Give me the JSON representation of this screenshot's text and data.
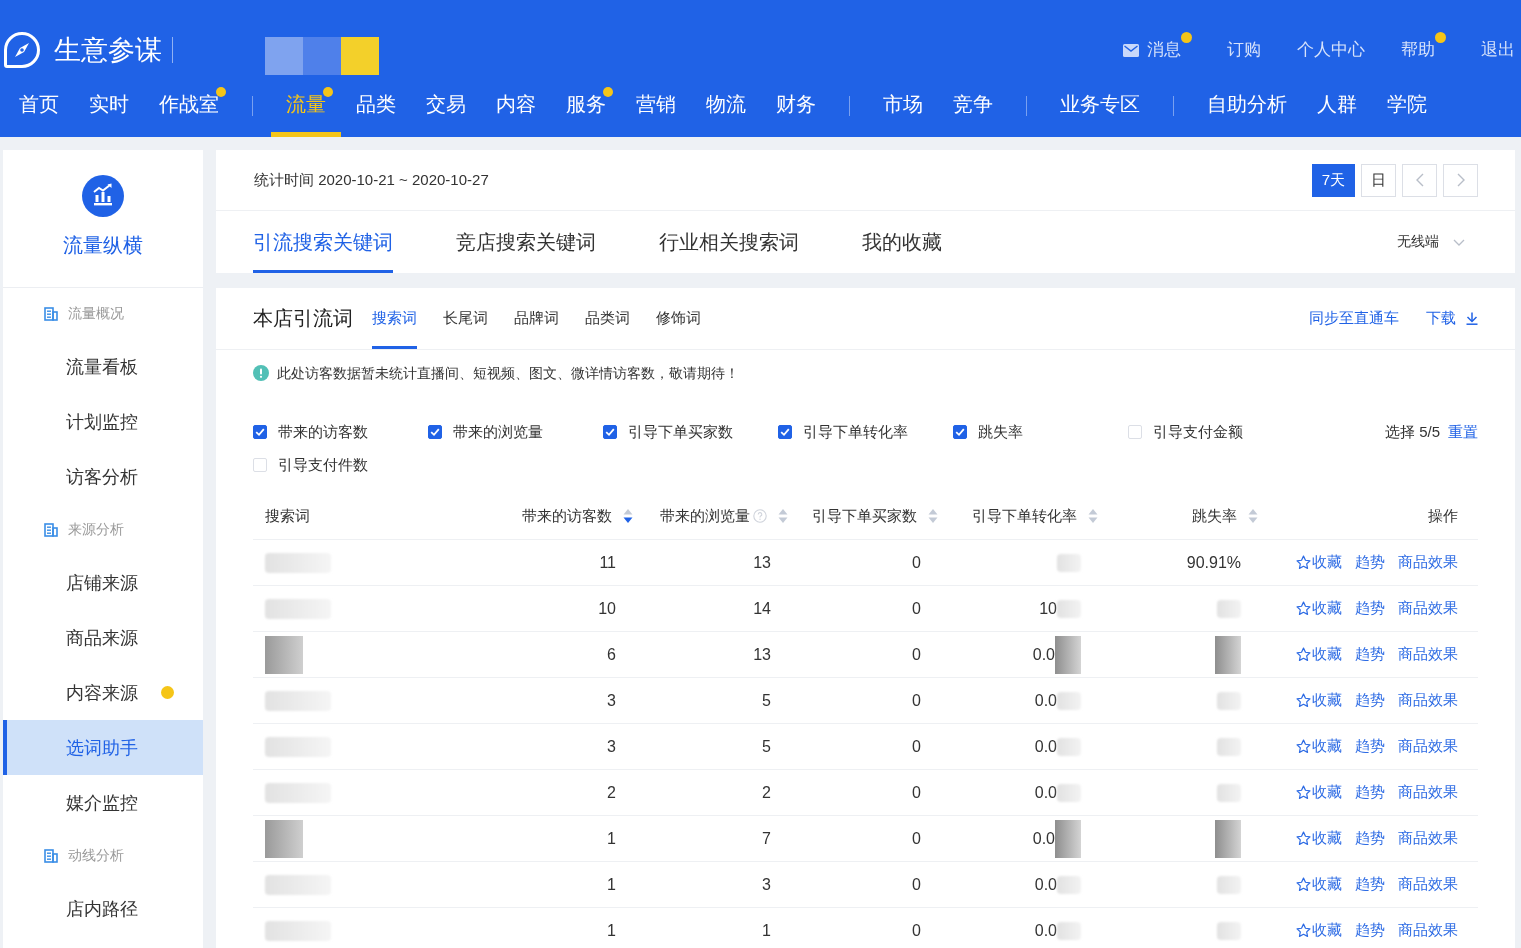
{
  "header": {
    "logo": "生意参谋",
    "shop_name_blurred": true,
    "links": [
      {
        "label": "消息",
        "kind": "mail",
        "dot": true
      },
      {
        "label": "订购",
        "kind": "plain",
        "dot": false
      },
      {
        "label": "个人中心",
        "kind": "plain",
        "dot": false
      },
      {
        "label": "帮助",
        "kind": "plain",
        "dot": true
      },
      {
        "label": "退出",
        "kind": "plain",
        "dot": false
      }
    ],
    "nav_groups": [
      [
        {
          "label": "首页",
          "selected": false,
          "dot": false
        },
        {
          "label": "实时",
          "selected": false,
          "dot": false
        },
        {
          "label": "作战室",
          "selected": false,
          "dot": true
        }
      ],
      [
        {
          "label": "流量",
          "selected": true,
          "dot": true
        },
        {
          "label": "品类",
          "selected": false,
          "dot": false
        },
        {
          "label": "交易",
          "selected": false,
          "dot": false
        },
        {
          "label": "内容",
          "selected": false,
          "dot": false
        },
        {
          "label": "服务",
          "selected": false,
          "dot": true
        },
        {
          "label": "营销",
          "selected": false,
          "dot": false
        },
        {
          "label": "物流",
          "selected": false,
          "dot": false
        },
        {
          "label": "财务",
          "selected": false,
          "dot": false
        }
      ],
      [
        {
          "label": "市场",
          "selected": false,
          "dot": false
        },
        {
          "label": "竞争",
          "selected": false,
          "dot": false
        }
      ],
      [
        {
          "label": "业务专区",
          "selected": false,
          "dot": false
        }
      ],
      [
        {
          "label": "自助分析",
          "selected": false,
          "dot": false
        },
        {
          "label": "人群",
          "selected": false,
          "dot": false
        },
        {
          "label": "学院",
          "selected": false,
          "dot": false
        }
      ]
    ]
  },
  "sidebar": {
    "title": "流量纵横",
    "groups": [
      {
        "label": "流量概况",
        "items": [
          {
            "label": "流量看板",
            "selected": false,
            "dot": false
          },
          {
            "label": "计划监控",
            "selected": false,
            "dot": false
          },
          {
            "label": "访客分析",
            "selected": false,
            "dot": false
          }
        ]
      },
      {
        "label": "来源分析",
        "items": [
          {
            "label": "店铺来源",
            "selected": false,
            "dot": false
          },
          {
            "label": "商品来源",
            "selected": false,
            "dot": false
          },
          {
            "label": "内容来源",
            "selected": false,
            "dot": true
          },
          {
            "label": "选词助手",
            "selected": true,
            "dot": false
          },
          {
            "label": "媒介监控",
            "selected": false,
            "dot": false
          }
        ]
      },
      {
        "label": "动线分析",
        "items": [
          {
            "label": "店内路径",
            "selected": false,
            "dot": false
          }
        ]
      }
    ]
  },
  "period": {
    "label": "统计时间 2020-10-21 ~ 2020-10-27",
    "ranges": [
      {
        "label": "7天",
        "selected": true
      },
      {
        "label": "日",
        "selected": false
      }
    ],
    "tabs": [
      {
        "label": "引流搜索关键词",
        "selected": true
      },
      {
        "label": "竞店搜索关键词",
        "selected": false
      },
      {
        "label": "行业相关搜索词",
        "selected": false
      },
      {
        "label": "我的收藏",
        "selected": false
      }
    ],
    "device": "无线端"
  },
  "panel": {
    "title": "本店引流词",
    "subtabs": [
      {
        "label": "搜索词",
        "selected": true
      },
      {
        "label": "长尾词",
        "selected": false
      },
      {
        "label": "品牌词",
        "selected": false
      },
      {
        "label": "品类词",
        "selected": false
      },
      {
        "label": "修饰词",
        "selected": false
      }
    ],
    "sync_link": "同步至直通车",
    "download": "下载",
    "notice": "此处访客数据暂未统计直播间、短视频、图文、微详情访客数，敬请期待！",
    "metrics": [
      {
        "label": "带来的访客数",
        "checked": true
      },
      {
        "label": "带来的浏览量",
        "checked": true
      },
      {
        "label": "引导下单买家数",
        "checked": true
      },
      {
        "label": "引导下单转化率",
        "checked": true
      },
      {
        "label": "跳失率",
        "checked": true
      },
      {
        "label": "引导支付金额",
        "checked": false
      },
      {
        "label": "引导支付件数",
        "checked": false
      }
    ],
    "selection": "选择 5/5",
    "reset": "重置",
    "table": {
      "columns": [
        {
          "label": "搜索词",
          "sortable": false,
          "sorted": false,
          "help": false
        },
        {
          "label": "带来的访客数",
          "sortable": true,
          "sorted": true,
          "help": false
        },
        {
          "label": "带来的浏览量",
          "sortable": true,
          "sorted": false,
          "help": true
        },
        {
          "label": "引导下单买家数",
          "sortable": true,
          "sorted": false,
          "help": false
        },
        {
          "label": "引导下单转化率",
          "sortable": true,
          "sorted": false,
          "help": false
        },
        {
          "label": "跳失率",
          "sortable": true,
          "sorted": false,
          "help": false
        },
        {
          "label": "操作",
          "sortable": false,
          "sorted": false,
          "help": false
        }
      ],
      "rows": [
        {
          "cells": [
            {
              "kind": "blurred"
            },
            {
              "text": "11",
              "kind": "plain"
            },
            {
              "text": "13",
              "kind": "plain"
            },
            {
              "text": "0",
              "kind": "plain"
            },
            {
              "kind": "blurred"
            },
            {
              "text": "90.91%",
              "kind": "plain"
            }
          ],
          "actions": [
            {
              "label": "收藏",
              "kind": "star"
            },
            {
              "label": "趋势",
              "kind": "plain"
            },
            {
              "label": "商品效果",
              "kind": "plain"
            }
          ]
        },
        {
          "cells": [
            {
              "kind": "blurred"
            },
            {
              "text": "10",
              "kind": "plain"
            },
            {
              "text": "14",
              "kind": "plain"
            },
            {
              "text": "0",
              "kind": "plain"
            },
            {
              "text": "10",
              "kind": "blurred"
            },
            {
              "kind": "blurred"
            }
          ],
          "actions": [
            {
              "label": "收藏",
              "kind": "star"
            },
            {
              "label": "趋势",
              "kind": "plain"
            },
            {
              "label": "商品效果",
              "kind": "plain"
            }
          ]
        },
        {
          "cells": [
            {
              "kind": "pixelated"
            },
            {
              "text": "6",
              "kind": "plain"
            },
            {
              "text": "13",
              "kind": "plain"
            },
            {
              "text": "0",
              "kind": "plain"
            },
            {
              "text": "0.0",
              "kind": "pixelated"
            },
            {
              "kind": "pixelated"
            }
          ],
          "actions": [
            {
              "label": "收藏",
              "kind": "star"
            },
            {
              "label": "趋势",
              "kind": "plain"
            },
            {
              "label": "商品效果",
              "kind": "plain"
            }
          ]
        },
        {
          "cells": [
            {
              "kind": "blurred"
            },
            {
              "text": "3",
              "kind": "plain"
            },
            {
              "text": "5",
              "kind": "plain"
            },
            {
              "text": "0",
              "kind": "plain"
            },
            {
              "text": "0.0",
              "kind": "blurred"
            },
            {
              "kind": "blurred"
            }
          ],
          "actions": [
            {
              "label": "收藏",
              "kind": "star"
            },
            {
              "label": "趋势",
              "kind": "plain"
            },
            {
              "label": "商品效果",
              "kind": "plain"
            }
          ]
        },
        {
          "cells": [
            {
              "kind": "blurred"
            },
            {
              "text": "3",
              "kind": "plain"
            },
            {
              "text": "5",
              "kind": "plain"
            },
            {
              "text": "0",
              "kind": "plain"
            },
            {
              "text": "0.0",
              "kind": "blurred"
            },
            {
              "kind": "blurred"
            }
          ],
          "actions": [
            {
              "label": "收藏",
              "kind": "star"
            },
            {
              "label": "趋势",
              "kind": "plain"
            },
            {
              "label": "商品效果",
              "kind": "plain"
            }
          ]
        },
        {
          "cells": [
            {
              "kind": "blurred"
            },
            {
              "text": "2",
              "kind": "plain"
            },
            {
              "text": "2",
              "kind": "plain"
            },
            {
              "text": "0",
              "kind": "plain"
            },
            {
              "text": "0.0",
              "kind": "blurred"
            },
            {
              "kind": "blurred"
            }
          ],
          "actions": [
            {
              "label": "收藏",
              "kind": "star"
            },
            {
              "label": "趋势",
              "kind": "plain"
            },
            {
              "label": "商品效果",
              "kind": "plain"
            }
          ]
        },
        {
          "cells": [
            {
              "kind": "pixelated"
            },
            {
              "text": "1",
              "kind": "plain"
            },
            {
              "text": "7",
              "kind": "plain"
            },
            {
              "text": "0",
              "kind": "plain"
            },
            {
              "text": "0.0",
              "kind": "pixelated"
            },
            {
              "kind": "pixelated"
            }
          ],
          "actions": [
            {
              "label": "收藏",
              "kind": "star"
            },
            {
              "label": "趋势",
              "kind": "plain"
            },
            {
              "label": "商品效果",
              "kind": "plain"
            }
          ]
        },
        {
          "cells": [
            {
              "kind": "blurred"
            },
            {
              "text": "1",
              "kind": "plain"
            },
            {
              "text": "3",
              "kind": "plain"
            },
            {
              "text": "0",
              "kind": "plain"
            },
            {
              "text": "0.0",
              "kind": "blurred"
            },
            {
              "kind": "blurred"
            }
          ],
          "actions": [
            {
              "label": "收藏",
              "kind": "star"
            },
            {
              "label": "趋势",
              "kind": "plain"
            },
            {
              "label": "商品效果",
              "kind": "plain"
            }
          ]
        },
        {
          "cells": [
            {
              "kind": "blurred"
            },
            {
              "text": "1",
              "kind": "plain"
            },
            {
              "text": "1",
              "kind": "plain"
            },
            {
              "text": "0",
              "kind": "plain"
            },
            {
              "text": "0.0",
              "kind": "blurred"
            },
            {
              "kind": "blurred"
            }
          ],
          "actions": [
            {
              "label": "收藏",
              "kind": "star"
            },
            {
              "label": "趋势",
              "kind": "plain"
            },
            {
              "label": "商品效果",
              "kind": "plain"
            }
          ]
        }
      ]
    }
  }
}
